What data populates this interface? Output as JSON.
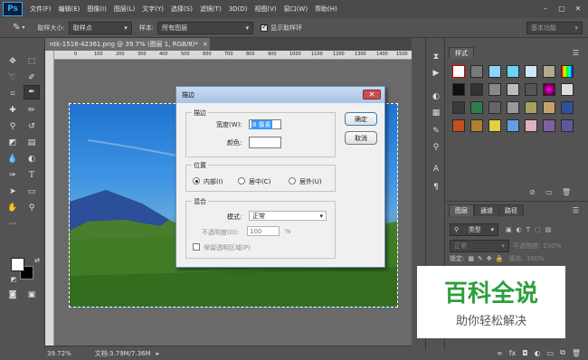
{
  "app": {
    "logo": "Ps",
    "menu": [
      "文件(F)",
      "编辑(E)",
      "图像(I)",
      "图层(L)",
      "文字(Y)",
      "选择(S)",
      "滤镜(T)",
      "3D(D)",
      "视图(V)",
      "窗口(W)",
      "帮助(H)"
    ],
    "window_controls": [
      "–",
      "▢",
      "✕"
    ]
  },
  "options_bar": {
    "sample_size_label": "取样大小:",
    "sample_size_value": "取样点",
    "sample_label": "样本:",
    "sample_value": "所有图层",
    "show_ring_label": "显示取样环",
    "show_ring_checked": true,
    "workspace_value": "基本功能"
  },
  "document": {
    "tab_title": "ntk-1516-42361.png @ 39.7% (图层 1, RGB/8)",
    "tab_modified": "*",
    "ruler_ticks": [
      "0",
      "100",
      "200",
      "300",
      "400",
      "500",
      "600",
      "700",
      "800",
      "900",
      "1000",
      "1100",
      "1200",
      "1300",
      "1400",
      "1500"
    ]
  },
  "status_bar": {
    "zoom": "39.72%",
    "doc_size": "文档:3.79M/7.36M"
  },
  "styles_panel": {
    "tab": "样式"
  },
  "layers_panel": {
    "tabs": [
      "图层",
      "通道",
      "路径"
    ],
    "filter_type": "类型",
    "blend_mode": "正常",
    "opacity_label": "不透明度:",
    "opacity_value": "100%",
    "lock_label": "锁定:",
    "fill_label": "填充:",
    "fill_value": "100%",
    "bottom_icons": [
      "∞",
      "fx"
    ]
  },
  "stroke_dialog": {
    "title": "描边",
    "close": "✕",
    "stroke_group": "描边",
    "width_label": "宽度(W):",
    "width_value": "8 像素",
    "color_label": "颜色:",
    "location_group": "位置",
    "location_options": [
      "内部(I)",
      "居中(C)",
      "居外(U)"
    ],
    "location_selected": "内部(I)",
    "blend_group": "混合",
    "mode_label": "模式:",
    "mode_value": "正常",
    "opacity_label": "不透明度(O):",
    "opacity_value": "100",
    "opacity_unit": "%",
    "preserve_transparency_label": "保留透明区域(P)",
    "ok_button": "确定",
    "cancel_button": "取消"
  },
  "watermark": {
    "main": "百科全说",
    "sub": "助你轻松解决"
  }
}
